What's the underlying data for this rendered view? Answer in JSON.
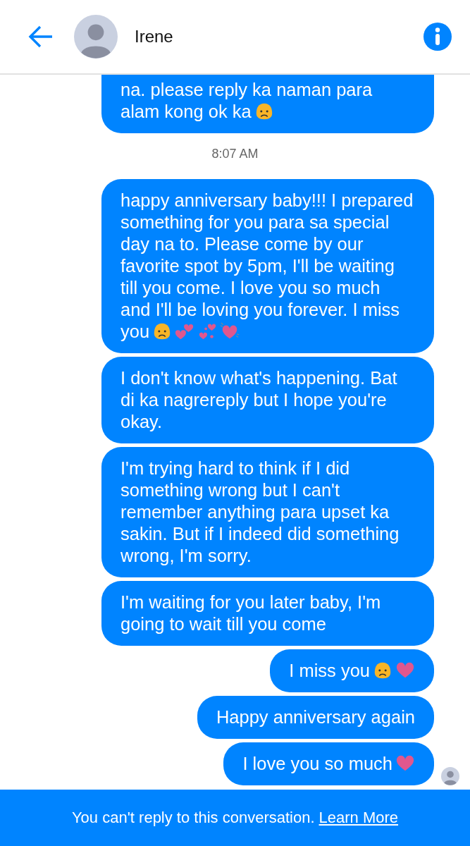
{
  "header": {
    "contact_name": "Irene"
  },
  "messages": [
    {
      "kind": "cut",
      "text": "na. please reply ka naman para alam kong ok ka",
      "emojis": [
        {
          "kind": "sad"
        }
      ]
    },
    {
      "kind": "time",
      "text": "8:07 AM"
    },
    {
      "kind": "sent",
      "text": "happy anniversary baby!!! I prepared something for you para sa special day na to. Please come by our favorite spot by 5pm, I'll be waiting till you come. I love you so much and I'll be loving you forever. I miss you",
      "emojis": [
        {
          "kind": "sad"
        },
        {
          "kind": "two-hearts"
        },
        {
          "kind": "hearts-burst"
        },
        {
          "kind": "beating-heart"
        }
      ]
    },
    {
      "kind": "sent",
      "text": "I don't know what's happening. Bat di ka nagrereply but I hope you're okay."
    },
    {
      "kind": "sent",
      "text": "I'm trying hard to think if I did something wrong but I can't remember anything para upset ka sakin. But if I indeed did something wrong, I'm sorry."
    },
    {
      "kind": "sent",
      "text": "I'm waiting for you later baby, I'm going to wait till you come"
    },
    {
      "kind": "sent",
      "text": "I miss you",
      "emojis": [
        {
          "kind": "sad"
        },
        {
          "kind": "heart"
        }
      ]
    },
    {
      "kind": "sent",
      "text": "Happy anniversary again"
    },
    {
      "kind": "sent",
      "text": "I love you so much",
      "emojis": [
        {
          "kind": "heart"
        }
      ],
      "seen": true
    }
  ],
  "footer": {
    "text": "You can't reply to this conversation.",
    "link": "Learn More"
  }
}
